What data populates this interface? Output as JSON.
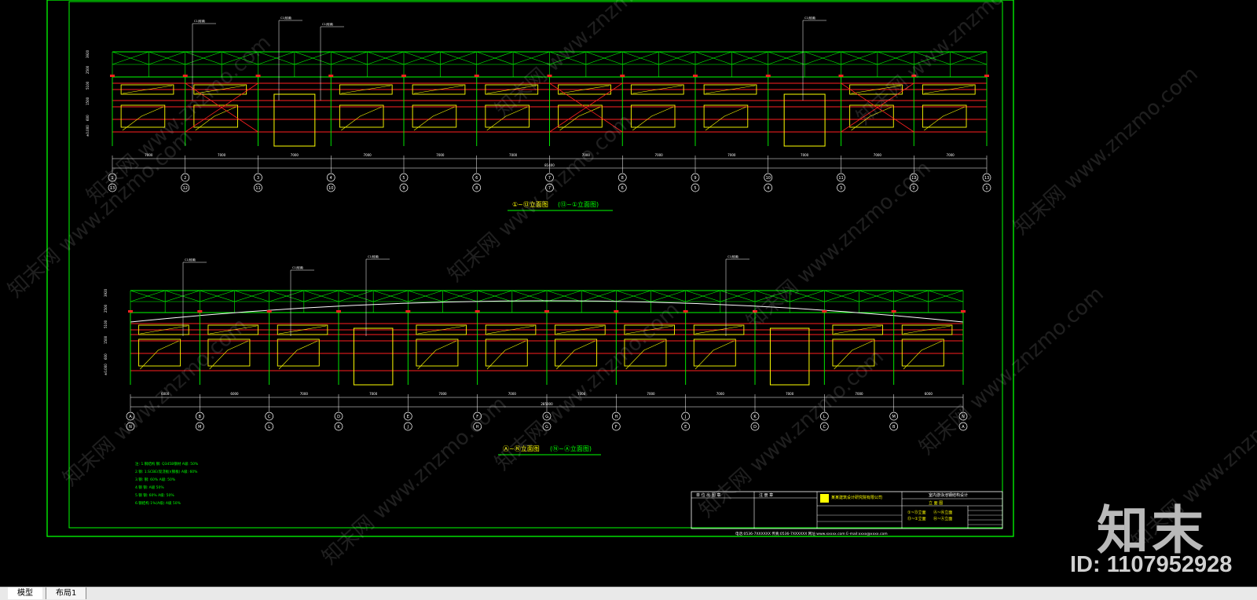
{
  "drawing": {
    "elevation_top_title_a": "①~⑬立面图",
    "elevation_top_title_b": "(⑬~①立面图)",
    "elevation_bottom_title_a": "Ⓐ~Ⓝ立面图",
    "elevation_bottom_title_b": "(Ⓝ~Ⓐ立面图)",
    "top_axis_labels": [
      "1",
      "2",
      "3",
      "4",
      "5",
      "6",
      "7",
      "8",
      "9",
      "10",
      "11",
      "12",
      "13"
    ],
    "top_axis_labels_rev": [
      "13",
      "12",
      "11",
      "10",
      "9",
      "8",
      "7",
      "6",
      "5",
      "4",
      "3",
      "2",
      "1"
    ],
    "bottom_axis_labels": [
      "A",
      "B",
      "C",
      "D",
      "E",
      "F",
      "G",
      "H",
      "J",
      "K",
      "L",
      "M",
      "N"
    ],
    "bottom_axis_labels_rev": [
      "N",
      "M",
      "L",
      "K",
      "J",
      "H",
      "G",
      "F",
      "E",
      "D",
      "C",
      "B",
      "A"
    ],
    "top_dims": [
      "7000",
      "7000",
      "7000",
      "7000",
      "7000",
      "7000",
      "7000",
      "7000",
      "7000",
      "7000",
      "7000",
      "7000"
    ],
    "top_total": "81400",
    "bottom_dims": [
      "6000",
      "6000",
      "7000",
      "7000",
      "7000",
      "7000",
      "7000",
      "7000",
      "7000",
      "7000",
      "7000",
      "6000",
      "6000"
    ],
    "bottom_total": "285000",
    "notes": [
      "注: 1.钢结构  钢: Q345B钢材   A级: 50%",
      "2.钢: 1.SCBE(现浇板)(钢板)    A级: 60%",
      "3.钢: 钢: 60%   A级: 50%",
      "4.钢 钢: A级 50%",
      "5.钢 钢: 60%   A级: 50%",
      "6.钢结构   1%(A级)  A级 50%"
    ],
    "titleblock": {
      "left_header_1": "单 位 出 图 章",
      "left_header_2": "注 册 章",
      "company": "某某建筑设计研究院有限公司",
      "project": "室内游泳池钢结构设计",
      "drawing_name": "立 面 图",
      "legend_1": "①~⑬立面",
      "legend_2": "Ⓐ~Ⓝ立面",
      "legend_3": "⑬~①立面",
      "legend_4": "Ⓝ~Ⓐ立面",
      "footer": "电话:0536-7XXXXXX  传真:0536-7XXXXXX  网址:www.xxxxx.com  E-mail:xxxx@xxxx.com"
    }
  },
  "tabs": {
    "model": "模型",
    "layout1": "布局1"
  },
  "watermark": {
    "logo": "知末",
    "id": "ID: 1107952928",
    "tile": "知末网 www.znzmo.com"
  },
  "colors": {
    "frame": "#00ff00",
    "beam": "#ff2020",
    "window": "#ffff00",
    "text": "#ffffff"
  }
}
